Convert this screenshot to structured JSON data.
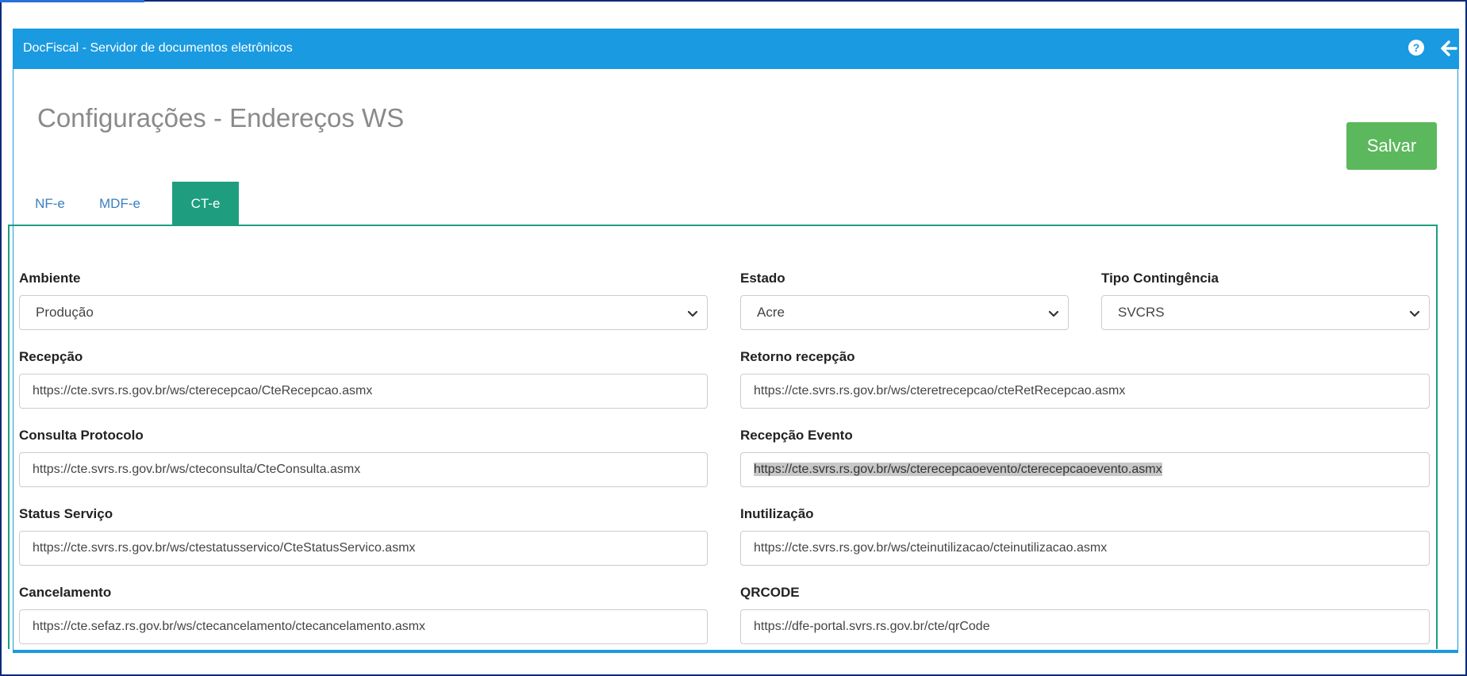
{
  "app": {
    "title": "DocFiscal - Servidor de documentos eletrônicos",
    "help_icon_glyph": "?"
  },
  "page": {
    "title": "Configurações - Endereços WS",
    "save_label": "Salvar"
  },
  "tabs": [
    {
      "label": "NF-e",
      "active": false
    },
    {
      "label": "MDF-e",
      "active": false
    },
    {
      "label": "CT-e",
      "active": true
    }
  ],
  "form": {
    "ambiente": {
      "label": "Ambiente",
      "value": "Produção"
    },
    "estado": {
      "label": "Estado",
      "value": "Acre"
    },
    "tipo_contingencia": {
      "label": "Tipo Contingência",
      "value": "SVCRS"
    },
    "recepcao": {
      "label": "Recepção",
      "value": "https://cte.svrs.rs.gov.br/ws/cterecepcao/CteRecepcao.asmx"
    },
    "retorno_recepcao": {
      "label": "Retorno recepção",
      "value": "https://cte.svrs.rs.gov.br/ws/cteretrecepcao/cteRetRecepcao.asmx"
    },
    "consulta_protocolo": {
      "label": "Consulta Protocolo",
      "value": "https://cte.svrs.rs.gov.br/ws/cteconsulta/CteConsulta.asmx"
    },
    "recepcao_evento": {
      "label": "Recepção Evento",
      "value": "https://cte.svrs.rs.gov.br/ws/cterecepcaoevento/cterecepcaoevento.asmx"
    },
    "status_servico": {
      "label": "Status Serviço",
      "value": "https://cte.svrs.rs.gov.br/ws/ctestatusservico/CteStatusServico.asmx"
    },
    "inutilizacao": {
      "label": "Inutilização",
      "value": "https://cte.svrs.rs.gov.br/ws/cteinutilizacao/cteinutilizacao.asmx"
    },
    "cancelamento": {
      "label": "Cancelamento",
      "value": "https://cte.sefaz.rs.gov.br/ws/ctecancelamento/ctecancelamento.asmx"
    },
    "qrcode": {
      "label": "QRCODE",
      "value": "https://dfe-portal.svrs.rs.gov.br/cte/qrCode"
    }
  },
  "colors": {
    "navbar": "#1a9ae0",
    "tab_active": "#1e9e7e",
    "save_button": "#5cb85c"
  }
}
